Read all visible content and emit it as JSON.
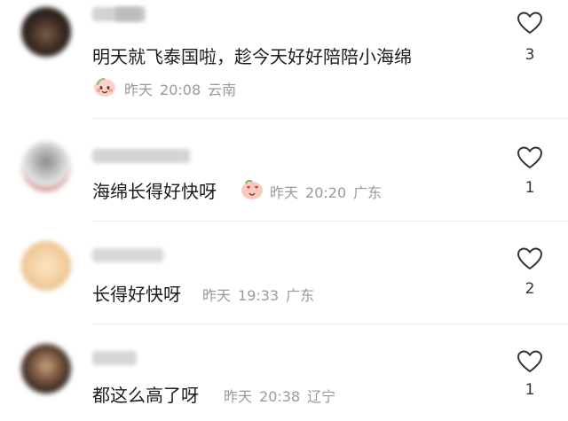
{
  "comments": [
    {
      "text": "明天就飞泰国啦，趁今天好好陪陪小海绵",
      "date": "昨天",
      "time": "20:08",
      "location": "云南",
      "likes": "3",
      "emoji": "peach-emoji"
    },
    {
      "text": "海绵长得好快呀",
      "date": "昨天",
      "time": "20:20",
      "location": "广东",
      "likes": "1",
      "emoji": "peach-heart-eyes-emoji"
    },
    {
      "text": "长得好快呀",
      "date": "昨天",
      "time": "19:33",
      "location": "广东",
      "likes": "2"
    },
    {
      "text": "都这么高了呀",
      "date": "昨天",
      "time": "20:38",
      "location": "辽宁",
      "likes": "1"
    }
  ],
  "icons": {
    "like": "heart-outline-icon"
  },
  "colors": {
    "meta_text": "#9a9a9a",
    "main_text": "#1c1c1c",
    "divider": "#ededed"
  }
}
